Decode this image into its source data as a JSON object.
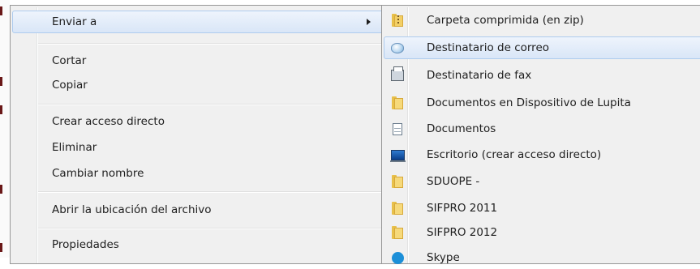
{
  "main_menu": {
    "items": [
      {
        "label": "Enviar a",
        "has_submenu": true,
        "highlighted": true
      },
      {
        "label": "Cortar"
      },
      {
        "label": "Copiar"
      },
      {
        "label": "Crear acceso directo"
      },
      {
        "label": "Eliminar"
      },
      {
        "label": "Cambiar nombre"
      },
      {
        "label": "Abrir la ubicación del archivo"
      },
      {
        "label": "Propiedades"
      }
    ]
  },
  "send_to_menu": {
    "items": [
      {
        "label": "Carpeta comprimida (en zip)",
        "icon": "zip-folder-icon"
      },
      {
        "label": "Destinatario de correo",
        "icon": "mail-recipient-icon",
        "highlighted": true
      },
      {
        "label": "Destinatario de fax",
        "icon": "fax-icon"
      },
      {
        "label": "Documentos en Dispositivo de Lupita",
        "icon": "folder-icon"
      },
      {
        "label": "Documentos",
        "icon": "documents-icon"
      },
      {
        "label": "Escritorio (crear acceso directo)",
        "icon": "desktop-icon"
      },
      {
        "label": "SDUOPE -",
        "icon": "folder-icon"
      },
      {
        "label": "SIFPRO 2011",
        "icon": "folder-icon"
      },
      {
        "label": "SIFPRO 2012",
        "icon": "folder-icon"
      },
      {
        "label": "Skype",
        "icon": "skype-icon"
      }
    ]
  },
  "colors": {
    "menu_background": "#f0f0f0",
    "highlight_border": "#aeccef",
    "highlight_fill": "#dce8f7"
  }
}
